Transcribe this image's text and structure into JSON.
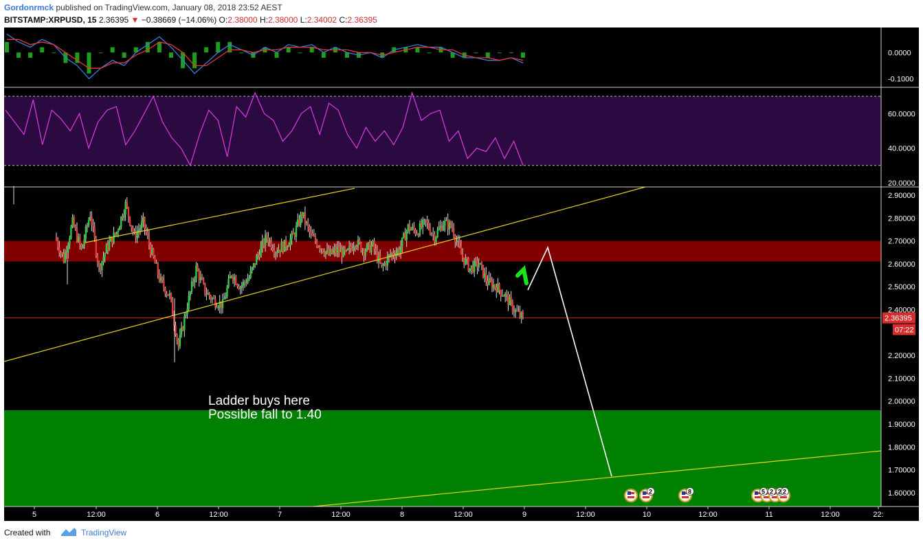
{
  "header": {
    "author": "Gordonrmck",
    "published_text": "published on TradingView.com, January 08, 2018 23:52 AEST",
    "symbol": "BITSTAMP:XRPUSD, 15",
    "last": "2.36395",
    "change": "−0.38669 (−14.06%)",
    "o_label": "O:",
    "o_val": "2.38000",
    "h_label": "H:",
    "h_val": "2.38000",
    "l_label": "L:",
    "l_val": "2.34002",
    "c_label": "C:",
    "c_val": "2.36395"
  },
  "footer": {
    "created_with": "Created with",
    "brand": "TradingView"
  },
  "colors": {
    "bg": "#000000",
    "up": "#2ecc40",
    "down": "#e53935",
    "resistance_zone": "#800000",
    "support_zone": "#008000",
    "trendline": "#e6d41e",
    "rsi_line": "#e03ce0",
    "rsi_band": "#2a0a40",
    "projection": "#ffffff",
    "arrow": "#19e619"
  },
  "chart_data": [
    {
      "type": "line",
      "panel": "macd",
      "ylim": [
        -0.13,
        0.09
      ],
      "tick_labels": [
        "0.0000",
        "-0.1000"
      ],
      "tick_values": [
        0.0,
        -0.1
      ],
      "series": [
        {
          "color": "#3b7ddd",
          "values": [
            0.07,
            0.04,
            0.02,
            0.05,
            0.03,
            -0.02,
            -0.05,
            -0.1,
            -0.06,
            -0.03,
            -0.05,
            0.0,
            0.03,
            0.06,
            0.02,
            -0.03,
            -0.08,
            -0.04,
            0.0,
            0.03,
            0.01,
            -0.01,
            0.02,
            0.0,
            0.03,
            0.02,
            0.03,
            0.0,
            0.02,
            0.0,
            -0.01,
            0.0,
            -0.02,
            0.01,
            0.02,
            0.03,
            0.02,
            0.02,
            0.0,
            -0.02,
            -0.02,
            -0.03,
            -0.03,
            -0.02,
            -0.04
          ]
        },
        {
          "color": "#e53935",
          "values": [
            0.05,
            0.05,
            0.03,
            0.04,
            0.03,
            0.0,
            -0.03,
            -0.06,
            -0.06,
            -0.04,
            -0.04,
            -0.01,
            0.01,
            0.04,
            0.03,
            0.0,
            -0.05,
            -0.05,
            -0.02,
            0.01,
            0.01,
            0.0,
            0.01,
            0.01,
            0.02,
            0.02,
            0.02,
            0.01,
            0.01,
            0.01,
            0.0,
            0.0,
            -0.01,
            0.0,
            0.01,
            0.02,
            0.02,
            0.01,
            0.01,
            -0.01,
            -0.02,
            -0.02,
            -0.03,
            -0.02,
            -0.03
          ]
        }
      ]
    },
    {
      "type": "line",
      "panel": "rsi",
      "ylim": [
        18,
        74
      ],
      "band": [
        30,
        70
      ],
      "tick_labels": [
        "60.0000",
        "40.0000",
        "20.0000"
      ],
      "tick_values": [
        60,
        40,
        20
      ],
      "series": [
        {
          "color": "#e03ce0",
          "values": [
            62,
            55,
            48,
            68,
            42,
            62,
            57,
            50,
            60,
            40,
            55,
            62,
            64,
            42,
            50,
            60,
            70,
            55,
            46,
            40,
            30,
            48,
            62,
            56,
            35,
            64,
            58,
            72,
            60,
            56,
            44,
            50,
            60,
            64,
            48,
            66,
            62,
            48,
            40,
            52,
            44,
            50,
            42,
            52,
            72,
            56,
            60,
            62,
            44,
            50,
            34,
            40,
            38,
            46,
            34,
            44,
            30
          ]
        }
      ]
    },
    {
      "type": "candlestick",
      "panel": "price",
      "ylim": [
        1.54,
        2.95
      ],
      "tick_labels": [
        "2.90000",
        "2.80000",
        "2.70000",
        "2.60000",
        "2.50000",
        "2.40000",
        "2.20000",
        "2.10000",
        "2.00000",
        "1.90000",
        "1.80000",
        "1.70000",
        "1.60000"
      ],
      "tick_values": [
        2.9,
        2.8,
        2.7,
        2.6,
        2.5,
        2.4,
        2.2,
        2.1,
        2.0,
        1.9,
        1.8,
        1.7,
        1.6
      ],
      "x_tick_labels": [
        "5",
        "12:00",
        "6",
        "12:00",
        "7",
        "12:00",
        "8",
        "12:00",
        "9",
        "12:00",
        "10",
        "12:00",
        "11",
        "12:00",
        "22:"
      ],
      "close_path": [
        2.72,
        2.62,
        2.78,
        2.66,
        2.82,
        2.58,
        2.68,
        2.74,
        2.86,
        2.72,
        2.78,
        2.64,
        2.52,
        2.46,
        2.24,
        2.42,
        2.58,
        2.48,
        2.44,
        2.42,
        2.56,
        2.5,
        2.54,
        2.64,
        2.72,
        2.66,
        2.68,
        2.72,
        2.82,
        2.72,
        2.68,
        2.64,
        2.66,
        2.64,
        2.7,
        2.66,
        2.68,
        2.58,
        2.64,
        2.66,
        2.76,
        2.74,
        2.78,
        2.72,
        2.78,
        2.76,
        2.64,
        2.58,
        2.6,
        2.52,
        2.5,
        2.46,
        2.4,
        2.36
      ],
      "last_price": "2.36395",
      "countdown": "07:22",
      "resistance_zone": [
        2.61,
        2.7
      ],
      "support_zone_top": 1.96,
      "annotation_line1": "Ladder buys here",
      "annotation_line2": "Possible fall to 1.40",
      "event_badges": [
        "2",
        "8",
        "5",
        "2",
        "2",
        "2"
      ]
    }
  ]
}
